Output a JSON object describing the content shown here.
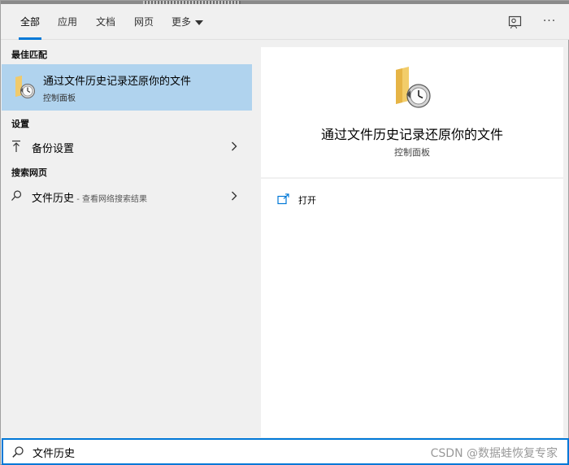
{
  "tabs": [
    {
      "label": "全部",
      "active": true
    },
    {
      "label": "应用",
      "active": false
    },
    {
      "label": "文档",
      "active": false
    },
    {
      "label": "网页",
      "active": false
    },
    {
      "label": "更多",
      "active": false,
      "dropdown": true
    }
  ],
  "toolbar": {
    "more_label": "···",
    "feedback_icon": "feedback-icon"
  },
  "left": {
    "best_match_heading": "最佳匹配",
    "best_match": {
      "title": "通过文件历史记录还原你的文件",
      "subtitle": "控制面板",
      "icon": "file-history-icon"
    },
    "settings_heading": "设置",
    "settings_item": {
      "label": "备份设置",
      "icon": "backup-arrow-icon"
    },
    "web_heading": "搜索网页",
    "web_item": {
      "label": "文件历史",
      "hint": " - 查看网络搜索结果",
      "icon": "search-icon"
    }
  },
  "detail": {
    "title": "通过文件历史记录还原你的文件",
    "subtitle": "控制面板",
    "actions": [
      {
        "label": "打开",
        "icon": "open-icon"
      }
    ]
  },
  "search": {
    "value": "文件历史",
    "watermark": "CSDN @数据蛙恢复专家"
  },
  "colors": {
    "accent": "#0078d7",
    "selected": "#b0d3ee",
    "pane_bg": "#f0f0f0"
  }
}
